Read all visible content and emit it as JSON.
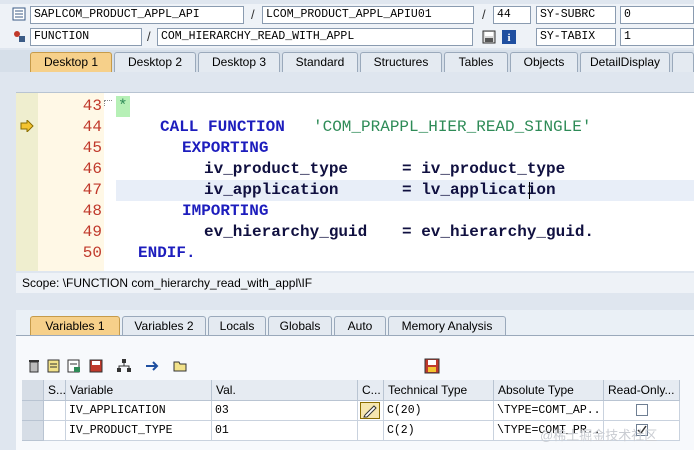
{
  "header": {
    "row1": {
      "program": "SAPLCOM_PRODUCT_APPL_API",
      "include": "LCOM_PRODUCT_APPL_APIU01",
      "line": "44",
      "sysvar_name": "SY-SUBRC",
      "sysvar_value": "0"
    },
    "row2": {
      "type": "FUNCTION",
      "name": "COM_HIERARCHY_READ_WITH_APPL",
      "sysvar_name": "SY-TABIX",
      "sysvar_value": "1"
    }
  },
  "top_tabs": [
    "Desktop 1",
    "Desktop 2",
    "Desktop 3",
    "Standard",
    "Structures",
    "Tables",
    "Objects",
    "DetailDisplay"
  ],
  "editor": {
    "lines": [
      {
        "num": "43",
        "text": "*"
      },
      {
        "num": "44",
        "kw": "CALL FUNCTION",
        "str": "'COM_PRAPPL_HIER_READ_SINGLE'"
      },
      {
        "num": "45",
        "kw": "EXPORTING"
      },
      {
        "num": "46",
        "left": "iv_product_type",
        "right": "= iv_product_type"
      },
      {
        "num": "47",
        "left": "iv_application",
        "right": "= lv_application"
      },
      {
        "num": "48",
        "kw": "IMPORTING"
      },
      {
        "num": "49",
        "left": "ev_hierarchy_guid",
        "right": "= ev_hierarchy_guid."
      },
      {
        "num": "50",
        "kw": "ENDIF."
      }
    ],
    "scope": "Scope: \\FUNCTION com_hierarchy_read_with_appl\\IF"
  },
  "var_tabs": [
    "Variables 1",
    "Variables 2",
    "Locals",
    "Globals",
    "Auto",
    "Memory Analysis"
  ],
  "table": {
    "headers": [
      "S...",
      "Variable",
      "Val.",
      "C...",
      "Technical Type",
      "Absolute Type",
      "Read-Only..."
    ],
    "rows": [
      {
        "variable": "IV_APPLICATION",
        "val": "03",
        "tech": "C(20)",
        "abs": "\\TYPE=COMT_AP...",
        "readonly": false
      },
      {
        "variable": "IV_PRODUCT_TYPE",
        "val": "01",
        "tech": "C(2)",
        "abs": "\\TYPE=COMT_PR...",
        "readonly": true
      }
    ]
  },
  "watermark": "@稀土掘金技术社区",
  "colors": {
    "active_tab": "#f6d08a",
    "line_number": "#c0392b",
    "keyword": "#1d1dbd",
    "string": "#2e8b57"
  }
}
